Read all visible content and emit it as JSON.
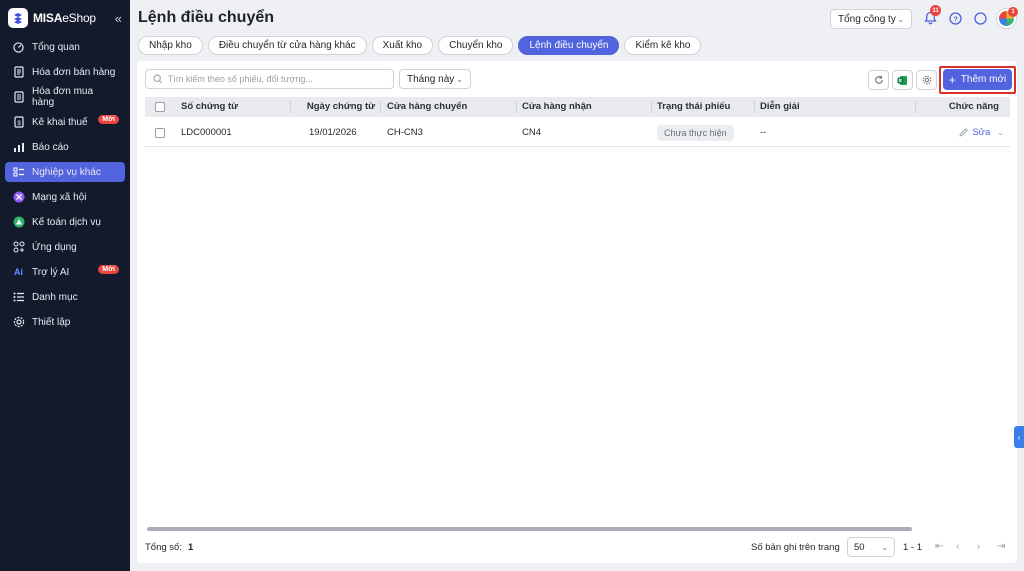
{
  "brand": {
    "name_bold": "MISA",
    "name_light": "eShop",
    "collapse_icon": "double-chevron-left-icon"
  },
  "sidebar": {
    "items": [
      {
        "label": "Tổng quan",
        "icon": "dashboard-icon"
      },
      {
        "label": "Hóa đơn bán hàng",
        "icon": "invoice-icon"
      },
      {
        "label": "Hóa đơn mua hàng",
        "icon": "purchase-invoice-icon"
      },
      {
        "label": "Kê khai thuế",
        "icon": "tax-icon",
        "badge": "Mới"
      },
      {
        "label": "Báo cáo",
        "icon": "bar-chart-icon"
      },
      {
        "label": "Nghiệp vụ khác",
        "icon": "list-icon",
        "active": true
      },
      {
        "label": "Mạng xã hội",
        "icon": "social-icon"
      },
      {
        "label": "Kế toán dịch vụ",
        "icon": "accounting-icon"
      },
      {
        "label": "Ứng dụng",
        "icon": "apps-icon"
      },
      {
        "label": "Trợ lý AI",
        "icon": "ai-icon",
        "badge": "Mới"
      },
      {
        "label": "Danh mục",
        "icon": "menu-list-icon"
      },
      {
        "label": "Thiết lập",
        "icon": "gear-icon"
      }
    ]
  },
  "header": {
    "title": "Lệnh điều chuyển",
    "company": "Tổng công ty",
    "notification_count": "11",
    "avatar_badge": "1"
  },
  "tabs": [
    {
      "label": "Nhập kho"
    },
    {
      "label": "Điều chuyển từ cửa hàng khác"
    },
    {
      "label": "Xuất kho"
    },
    {
      "label": "Chuyển kho"
    },
    {
      "label": "Lệnh điều chuyển",
      "active": true
    },
    {
      "label": "Kiểm kê kho"
    }
  ],
  "toolbar": {
    "search_placeholder": "Tìm kiếm theo số phiếu, đối tượng...",
    "period": "Tháng này",
    "add_label": "Thêm mới"
  },
  "table": {
    "columns": [
      "Số chứng từ",
      "Ngày chứng từ",
      "Cửa hàng chuyển",
      "Cửa hàng nhận",
      "Trạng thái phiếu",
      "Diễn giải",
      "Chức năng"
    ],
    "rows": [
      {
        "doc_no": "LDC000001",
        "date": "19/01/2026",
        "from_store": "CH-CN3",
        "to_store": "CN4",
        "status": "Chưa thực hiện",
        "description": "--",
        "action": "Sửa"
      }
    ]
  },
  "footer": {
    "total_label": "Tổng số:",
    "total_value": "1",
    "page_size_label": "Số bản ghi trên trang",
    "page_size": "50",
    "range": "1 - 1"
  },
  "colors": {
    "sidebar_bg": "#131a2b",
    "accent": "#5163dd",
    "badge": "#e8453c",
    "highlight": "#d9302c"
  }
}
